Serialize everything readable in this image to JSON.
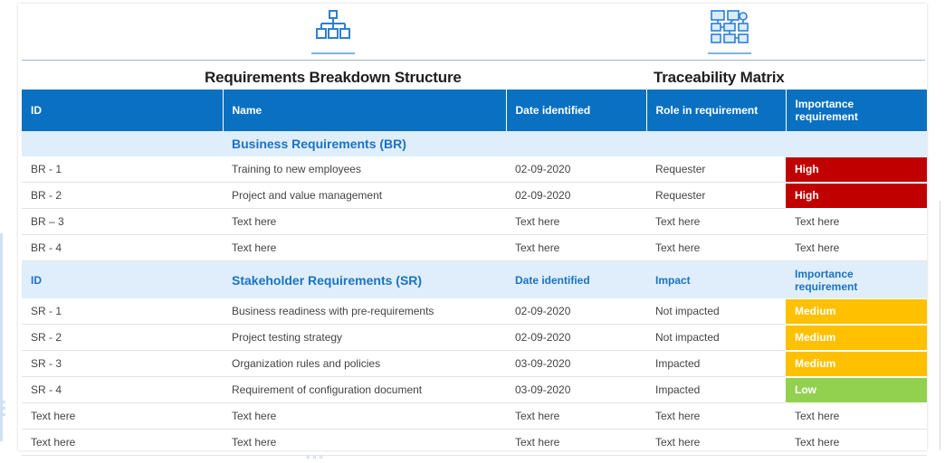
{
  "headings": {
    "left": "Requirements Breakdown Structure",
    "right": "Traceability Matrix"
  },
  "icons": {
    "left": "hierarchy-icon",
    "right": "traceability-network-icon"
  },
  "colors": {
    "header_blue": "#0a70c2",
    "section_bg": "#dfeefa",
    "high": "#c00000",
    "medium": "#ffc000",
    "low": "#92d050"
  },
  "table": {
    "columns": [
      "ID",
      "Name",
      "Date identified",
      "Role in requirement",
      "Importance requirement"
    ],
    "br_section": {
      "title": "Business Requirements (BR)"
    },
    "br_rows": [
      [
        "BR - 1",
        "Training to new employees",
        "02-09-2020",
        "Requester",
        "High"
      ],
      [
        "BR - 2",
        "Project and value management",
        "02-09-2020",
        "Requester",
        "High"
      ],
      [
        "BR – 3",
        "Text here",
        "Text here",
        "Text here",
        "Text here"
      ],
      [
        "BR - 4",
        "Text here",
        "Text here",
        "Text here",
        "Text here"
      ]
    ],
    "sr_section": {
      "id": "ID",
      "title": "Stakeholder Requirements (SR)",
      "date": "Date identified",
      "impact": "Impact",
      "importance": "Importance requirement"
    },
    "sr_rows": [
      [
        "SR - 1",
        "Business readiness with pre-requirements",
        "02-09-2020",
        "Not impacted",
        "Medium"
      ],
      [
        "SR - 2",
        "Project testing strategy",
        "02-09-2020",
        "Not impacted",
        "Medium"
      ],
      [
        "SR - 3",
        "Organization rules and policies",
        "03-09-2020",
        "Impacted",
        "Medium"
      ],
      [
        "SR - 4",
        "Requirement of configuration document",
        "03-09-2020",
        "Impacted",
        "Low"
      ],
      [
        "Text here",
        "Text here",
        "Text here",
        "Text here",
        "Text here"
      ],
      [
        "Text here",
        "Text here",
        "Text here",
        "Text here",
        "Text here"
      ]
    ]
  }
}
